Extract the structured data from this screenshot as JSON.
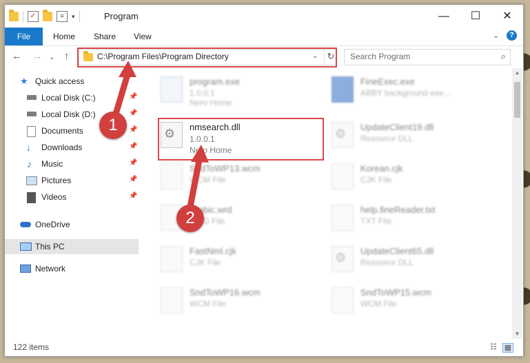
{
  "window": {
    "title": "Program",
    "controls": {
      "minimize": "—",
      "maximize": "☐",
      "close": "✕"
    }
  },
  "ribbon": {
    "tabs": [
      "File",
      "Home",
      "Share",
      "View"
    ],
    "help": "?"
  },
  "address_bar": {
    "path": "C:\\Program Files\\Program Directory"
  },
  "search": {
    "placeholder": "Search Program"
  },
  "sidebar": {
    "items": [
      {
        "label": "Quick access",
        "icon": "star-icon"
      },
      {
        "label": "Local Disk (C:)",
        "icon": "drive-icon",
        "pinned": true
      },
      {
        "label": "Local Disk (D:)",
        "icon": "drive-icon",
        "pinned": true
      },
      {
        "label": "Documents",
        "icon": "documents-icon",
        "pinned": true
      },
      {
        "label": "Downloads",
        "icon": "download-icon",
        "pinned": true
      },
      {
        "label": "Music",
        "icon": "music-icon",
        "pinned": true
      },
      {
        "label": "Pictures",
        "icon": "pictures-icon",
        "pinned": true
      },
      {
        "label": "Videos",
        "icon": "videos-icon",
        "pinned": true
      },
      {
        "label": "OneDrive",
        "icon": "cloud-icon"
      },
      {
        "label": "This PC",
        "icon": "computer-icon",
        "selected": true
      },
      {
        "label": "Network",
        "icon": "network-icon"
      }
    ]
  },
  "files": [
    {
      "name": "program.exe",
      "line1": "1.0.0.1",
      "line2": "Nero Home",
      "blurred": true
    },
    {
      "name": "FineExec.exe",
      "line1": "ABBY background exe...",
      "blurred": true
    },
    {
      "name": "nmsearch.dll",
      "line1": "1.0.0.1",
      "line2": "Nero Home",
      "blurred": false
    },
    {
      "name": "UpdateClient19.dll",
      "line1": "Resource DLL",
      "blurred": true
    },
    {
      "name": "SndToWP13.wcm",
      "line1": "WCM File",
      "blurred": true
    },
    {
      "name": "Korean.cjk",
      "line1": "CJK File",
      "blurred": true
    },
    {
      "name": "Arabic.wrd",
      "line1": "WRD File",
      "blurred": true
    },
    {
      "name": "help.fineReader.txt",
      "line1": "TXT File",
      "blurred": true
    },
    {
      "name": "FastNml.cjk",
      "line1": "CJK File",
      "blurred": true
    },
    {
      "name": "UpdateClient65.dll",
      "line1": "Resource DLL",
      "blurred": true
    },
    {
      "name": "SndToWP16.wcm",
      "line1": "WCM File",
      "blurred": true
    },
    {
      "name": "SndToWP15.wcm",
      "line1": "WCM File",
      "blurred": true
    }
  ],
  "annotations": {
    "step1": "1",
    "step2": "2",
    "highlight_color": "#d94848"
  },
  "status": {
    "item_count": "122 items"
  },
  "colors": {
    "accent": "#1979ca",
    "annotation": "#d23f3f"
  }
}
